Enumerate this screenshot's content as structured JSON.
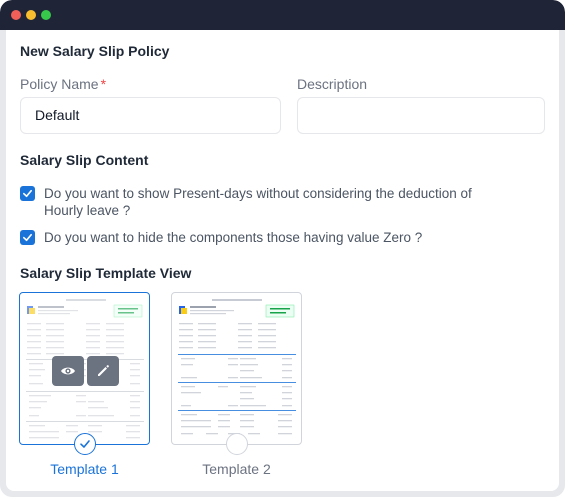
{
  "page_title": "New Salary Slip Policy",
  "form": {
    "policy_name_label": "Policy Name",
    "policy_name_required": "*",
    "policy_name_value": "Default",
    "description_label": "Description",
    "description_value": ""
  },
  "content_section": {
    "title": "Salary Slip Content",
    "options": [
      {
        "text": "Do you want to show Present-days without considering the deduction of Hourly leave ?",
        "checked": true
      },
      {
        "text": "Do you want to hide the components those having value Zero ?",
        "checked": true
      }
    ]
  },
  "template_section": {
    "title": "Salary Slip Template View",
    "templates": [
      {
        "name": "Template 1",
        "selected": true
      },
      {
        "name": "Template 2",
        "selected": false
      }
    ]
  },
  "colors": {
    "accent": "#1a73d9",
    "titlebar": "#1f2436",
    "required": "#ef4444"
  },
  "icons": {
    "view": "eye-icon",
    "edit": "pencil-icon",
    "selected": "check-icon"
  }
}
